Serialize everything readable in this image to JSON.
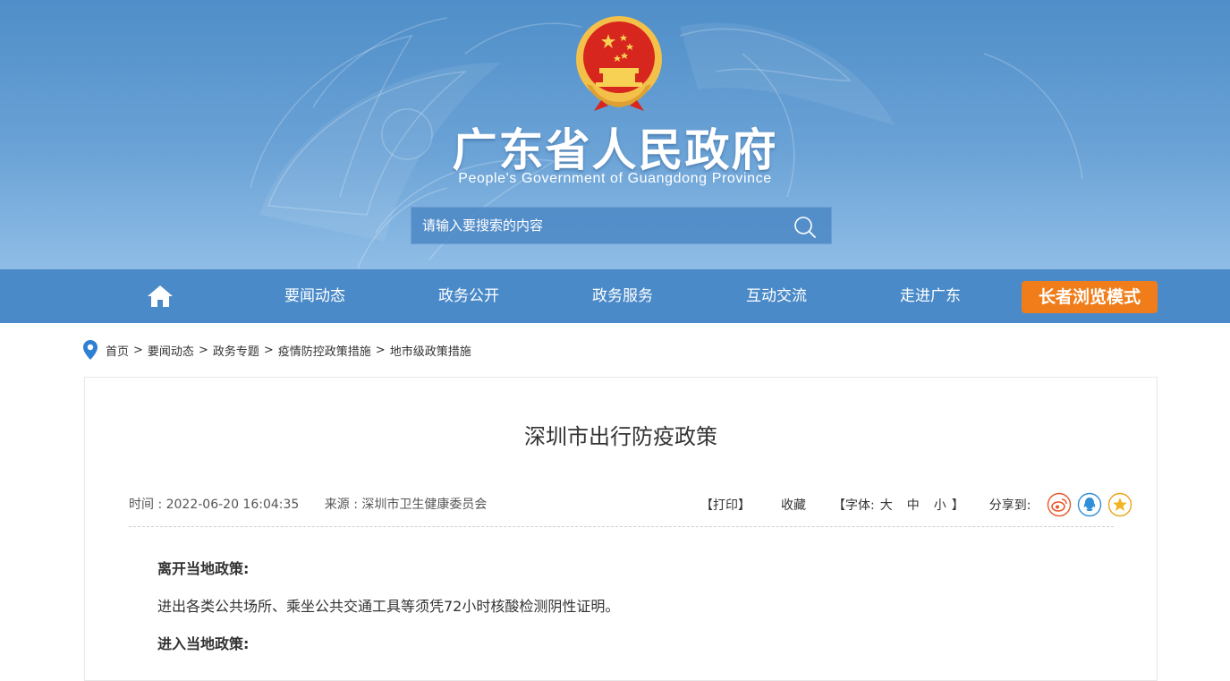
{
  "header": {
    "title": "广东省人民政府",
    "subtitle": "People's Government of Guangdong Province",
    "search_placeholder": "请输入要搜索的内容",
    "emblem_icon": "national-emblem-icon"
  },
  "nav": {
    "home_icon": "home-icon",
    "items": [
      "要闻动态",
      "政务公开",
      "政务服务",
      "互动交流",
      "走进广东"
    ],
    "elder_mode": "长者浏览模式"
  },
  "breadcrumb": [
    "首页",
    "要闻动态",
    "政务专题",
    "疫情防控政策措施",
    "地市级政策措施"
  ],
  "article": {
    "title": "深圳市出行防疫政策",
    "time": "时间 : 2022-06-20 16:04:35",
    "source": "来源 : 深圳市卫生健康委员会",
    "print": "【打印】",
    "favorite": "收藏",
    "font_open": "【字体:",
    "font_large": "大",
    "font_medium": "中",
    "font_small": "小",
    "font_close": "】",
    "share_label": "分享到:",
    "paragraphs": [
      "离开当地政策:",
      "进出各类公共场所、乘坐公共交通工具等须凭72小时核酸检测阴性证明。",
      "进入当地政策:"
    ]
  },
  "colors": {
    "banner_top": "#4f8ec8",
    "nav_bg": "#4a8ac8",
    "elder_btn": "#f07d19",
    "emblem_red": "#d7261e",
    "emblem_gold": "#f3c04a"
  }
}
